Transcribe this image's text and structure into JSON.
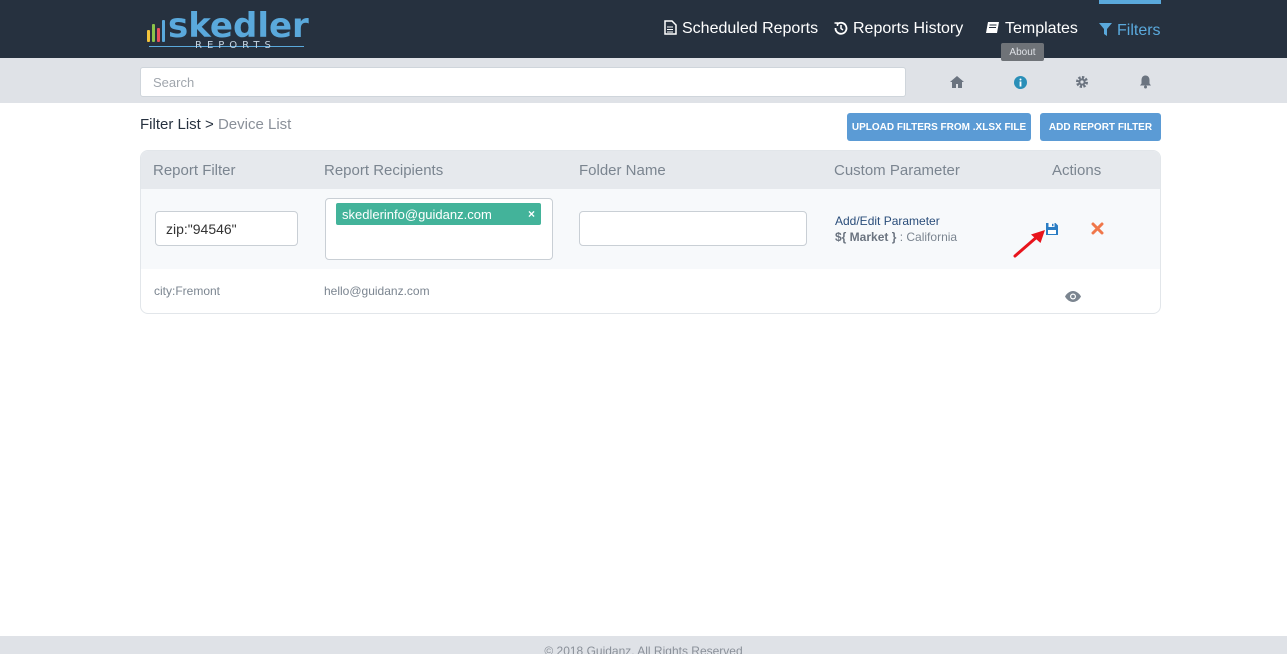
{
  "app": {
    "logo_text": "skedler",
    "logo_sub": "REPORTS"
  },
  "nav": {
    "scheduled_reports": "Scheduled Reports",
    "reports_history": "Reports History",
    "templates": "Templates",
    "filters": "Filters"
  },
  "search": {
    "placeholder": "Search"
  },
  "tooltip": {
    "about": "About"
  },
  "breadcrumb": {
    "parent": "Filter List >",
    "current": "Device List"
  },
  "buttons": {
    "upload": "UPLOAD FILTERS FROM .XLSX FILE",
    "add": "ADD REPORT FILTER"
  },
  "table": {
    "headers": [
      "Report Filter",
      "Report Recipients",
      "Folder Name",
      "Custom Parameter",
      "Actions"
    ],
    "edit_row": {
      "filter_value": "zip:\"94546\"",
      "recipient_chip": "skedlerinfo@guidanz.com",
      "folder_value": "",
      "custom_param_link": "Add/Edit Parameter",
      "custom_param_key": "${ Market }",
      "custom_param_value": ": California"
    },
    "rows": [
      {
        "filter": "city:Fremont",
        "recipients": "hello@guidanz.com"
      }
    ]
  },
  "footer": {
    "text": "© 2018 Guidanz. All Rights Reserved"
  },
  "colors": {
    "topbar": "#26313f",
    "accent": "#5aa9dc",
    "button": "#5b9bd5",
    "chip": "#43b39a",
    "delete": "#f0774a",
    "arrow": "#e8141c"
  },
  "icons": {
    "nav": [
      "document-icon",
      "history-icon",
      "book-icon",
      "filter-icon"
    ],
    "subbar": [
      "home-icon",
      "info-icon",
      "gear-icon",
      "bell-icon"
    ],
    "actions": [
      "save-icon",
      "delete-icon",
      "eye-icon"
    ]
  }
}
